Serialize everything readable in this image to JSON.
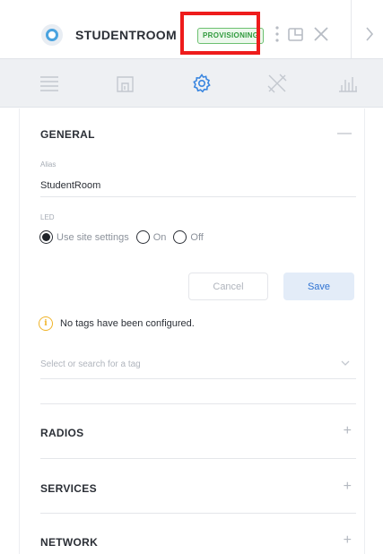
{
  "header": {
    "device_name": "STUDENTROOM",
    "status": "PROVISIONING"
  },
  "icons": {
    "device": "device-status-icon",
    "more": "more-vertical-icon",
    "popout": "popout-window-icon",
    "close": "close-icon",
    "next": "chevron-right-icon"
  },
  "tabs": [
    {
      "name": "details",
      "icon": "list-icon",
      "active": false
    },
    {
      "name": "device",
      "icon": "device-icon",
      "active": false
    },
    {
      "name": "settings",
      "icon": "gear-icon",
      "active": true
    },
    {
      "name": "tools",
      "icon": "tools-icon",
      "active": false
    },
    {
      "name": "stats",
      "icon": "bar-chart-icon",
      "active": false
    }
  ],
  "general": {
    "title": "GENERAL",
    "toggle": "—",
    "alias_label": "Alias",
    "alias_value": "StudentRoom",
    "led_label": "LED",
    "led_options": [
      {
        "label": "Use site settings",
        "checked": true
      },
      {
        "label": "On",
        "checked": false
      },
      {
        "label": "Off",
        "checked": false
      }
    ],
    "cancel_label": "Cancel",
    "save_label": "Save",
    "tags_message": "No tags have been configured.",
    "tag_select_placeholder": "Select or search for a tag"
  },
  "sections": [
    {
      "title": "RADIOS",
      "toggle": "+"
    },
    {
      "title": "SERVICES",
      "toggle": "+"
    },
    {
      "title": "NETWORK",
      "toggle": "+"
    }
  ],
  "colors": {
    "accent": "#2e72d2",
    "provisioning_green": "#2f9a3c",
    "highlight_red": "#ee1c1c",
    "info_yellow": "#f0b429"
  }
}
